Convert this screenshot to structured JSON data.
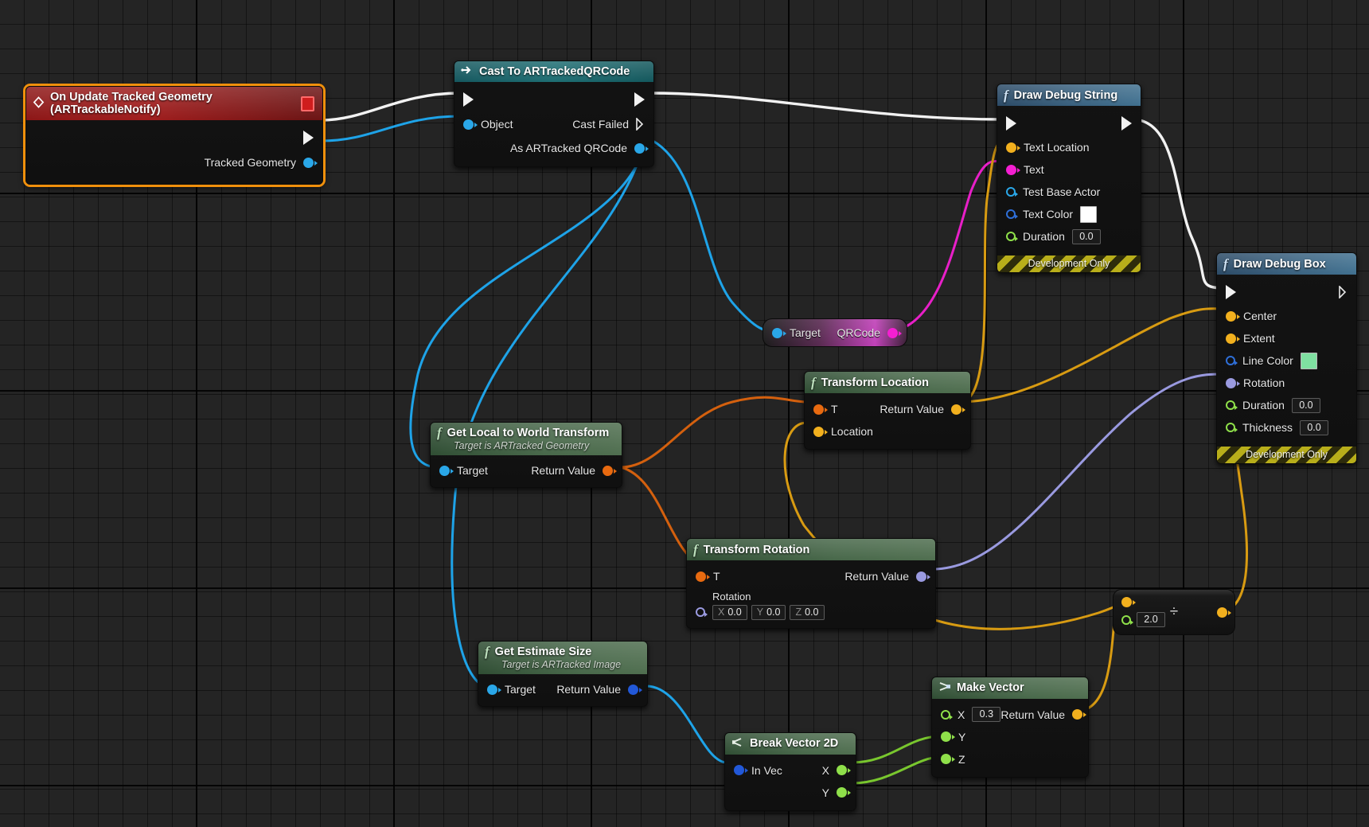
{
  "graph": {
    "app": "Unreal Engine Blueprint Event Graph",
    "background_color": "#242424",
    "grid_color": "#000000"
  },
  "colors": {
    "exec_white": "#f2f2f2",
    "object_blue": "#2aa7e8",
    "vector_gold": "#f2b01e",
    "transform_orange": "#e86a10",
    "string_magenta": "#f51fd2",
    "bool_red": "#8b0a0a",
    "float_green": "#8fe04a",
    "rotator_periwinkle": "#9a9ae0",
    "text_color_swatch": "#ffffff",
    "line_color_swatch": "#7fe0a1",
    "event_header": "#a11d1d",
    "function_header": "#5d8153",
    "cast_header": "#1d6d72",
    "debug_header": "#40708f",
    "selection_outline": "#f0900c"
  },
  "nodes": {
    "event": {
      "title": "On Update Tracked Geometry (ARTrackableNotify)",
      "icon": "event-diamond-icon",
      "delegate_icon": "delegate-square-icon",
      "out_exec": "",
      "out_pins": [
        {
          "label": "Tracked Geometry",
          "type": "object"
        }
      ]
    },
    "cast": {
      "title": "Cast To ARTrackedQRCode",
      "icon": "cast-arrow-icon",
      "in_pins": [
        {
          "label": "Object",
          "type": "object"
        }
      ],
      "out_pins": [
        {
          "label": "Cast Failed",
          "type": "exec-outline"
        },
        {
          "label": "As ARTracked QRCode",
          "type": "object"
        }
      ]
    },
    "draw_debug_string": {
      "title": "Draw Debug String",
      "icon": "function-f-icon",
      "in_pins": [
        {
          "label": "Text Location",
          "type": "vector",
          "value": null
        },
        {
          "label": "Text",
          "type": "string",
          "value": null
        },
        {
          "label": "Test Base Actor",
          "type": "object-hollow",
          "value": null
        },
        {
          "label": "Text Color",
          "type": "struct-hollow",
          "value": "#ffffff"
        },
        {
          "label": "Duration",
          "type": "float-hollow",
          "value": "0.0"
        }
      ],
      "footer": "Development Only"
    },
    "draw_debug_box": {
      "title": "Draw Debug Box",
      "icon": "function-f-icon",
      "in_pins": [
        {
          "label": "Center",
          "type": "vector",
          "value": null
        },
        {
          "label": "Extent",
          "type": "vector",
          "value": null
        },
        {
          "label": "Line Color",
          "type": "struct-hollow",
          "value": "#7fe0a1"
        },
        {
          "label": "Rotation",
          "type": "rotator",
          "value": null
        },
        {
          "label": "Duration",
          "type": "float-hollow",
          "value": "0.0"
        },
        {
          "label": "Thickness",
          "type": "float-hollow",
          "value": "0.0"
        }
      ],
      "footer": "Development Only"
    },
    "qrcode": {
      "in_label": "Target",
      "out_label": "QRCode"
    },
    "transform_location": {
      "title": "Transform Location",
      "icon": "function-f-icon",
      "in_pins": [
        {
          "label": "T",
          "type": "transform"
        },
        {
          "label": "Location",
          "type": "vector"
        }
      ],
      "out_pins": [
        {
          "label": "Return Value",
          "type": "vector"
        }
      ]
    },
    "transform_rotation": {
      "title": "Transform Rotation",
      "icon": "function-f-icon",
      "in_pins": [
        {
          "label": "T",
          "type": "transform"
        }
      ],
      "rotation_label": "Rotation",
      "rotation_value": {
        "x_axis": "X",
        "x": "0.0",
        "y_axis": "Y",
        "y": "0.0",
        "z_axis": "Z",
        "z": "0.0"
      },
      "out_pins": [
        {
          "label": "Return Value",
          "type": "rotator"
        }
      ]
    },
    "get_local_to_world": {
      "title": "Get Local to World Transform",
      "subtitle": "Target is ARTracked Geometry",
      "icon": "function-f-icon",
      "in_pins": [
        {
          "label": "Target",
          "type": "object"
        }
      ],
      "out_pins": [
        {
          "label": "Return Value",
          "type": "transform"
        }
      ]
    },
    "get_estimate_size": {
      "title": "Get Estimate Size",
      "subtitle": "Target is ARTracked Image",
      "icon": "function-f-icon",
      "in_pins": [
        {
          "label": "Target",
          "type": "object"
        }
      ],
      "out_pins": [
        {
          "label": "Return Value",
          "type": "object"
        }
      ]
    },
    "break_vector_2d": {
      "title": "Break Vector 2D",
      "icon": "break-struct-icon",
      "in_pins": [
        {
          "label": "In Vec",
          "type": "object"
        }
      ],
      "out_pins": [
        {
          "label": "X",
          "type": "float"
        },
        {
          "label": "Y",
          "type": "float"
        }
      ]
    },
    "make_vector": {
      "title": "Make Vector",
      "icon": "make-struct-icon",
      "in_pins": [
        {
          "label": "X",
          "type": "float-hollow",
          "value": "0.3"
        },
        {
          "label": "Y",
          "type": "float",
          "value": null
        },
        {
          "label": "Z",
          "type": "float",
          "value": null
        }
      ],
      "out_pins": [
        {
          "label": "Return Value",
          "type": "vector"
        }
      ]
    },
    "divide": {
      "operator": "÷",
      "icon": "divide-icon",
      "in_pins": [
        {
          "label": "",
          "type": "vector",
          "value": null
        },
        {
          "label": "",
          "type": "float-hollow",
          "value": "2.0"
        }
      ],
      "out_pins": [
        {
          "label": "",
          "type": "vector"
        }
      ]
    }
  }
}
